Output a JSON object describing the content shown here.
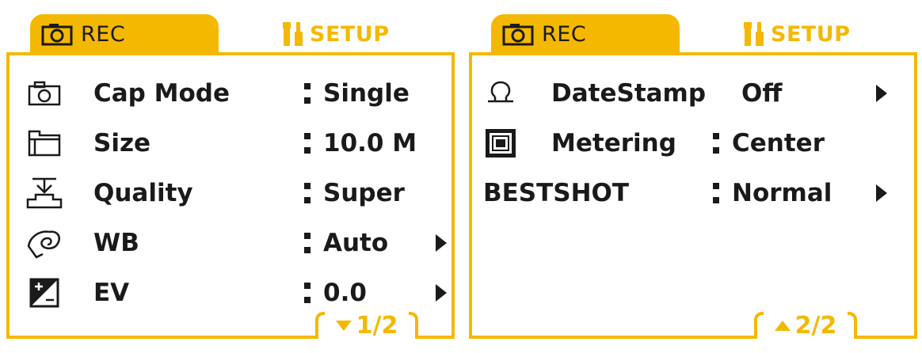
{
  "colors": {
    "accent": "#f5b800",
    "text": "#1a1a1a",
    "background": "#ffffff"
  },
  "left": {
    "tabs": {
      "rec": "REC",
      "setup": "SETUP"
    },
    "rows": [
      {
        "icon": "camera-icon",
        "label": "Cap Mode",
        "value": "Single"
      },
      {
        "icon": "folder-size-icon",
        "label": "Size",
        "value": "10.0 M"
      },
      {
        "icon": "quality-stamp-icon",
        "label": "Quality",
        "value": "Super"
      },
      {
        "icon": "white-balance-icon",
        "label": "WB",
        "value": "Auto"
      },
      {
        "icon": "exposure-compensation-icon",
        "label": "EV",
        "value": "0.0"
      }
    ],
    "page": "1/2"
  },
  "right": {
    "tabs": {
      "rec": "REC",
      "setup": "SETUP"
    },
    "rows": [
      {
        "icon": "date-stamp-icon",
        "label": "DateStamp",
        "value": "Off"
      },
      {
        "icon": "metering-icon",
        "label": "Metering",
        "value": "Center"
      },
      {
        "label": "BESTSHOT",
        "value": "Normal"
      }
    ],
    "page": "2/2"
  }
}
